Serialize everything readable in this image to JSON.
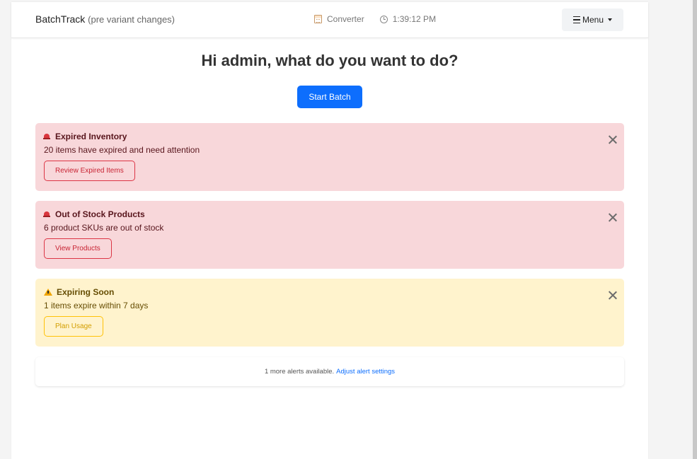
{
  "navbar": {
    "brand": "BatchTrack",
    "brand_sub": "(pre variant changes)",
    "converter_label": "Converter",
    "time": "1:39:12 PM",
    "menu_label": "Menu"
  },
  "hero": {
    "greeting": "Hi admin, what do you want to do?",
    "start_batch_label": "Start Batch"
  },
  "alerts": [
    {
      "level": "danger",
      "icon": "siren-icon",
      "title": "Expired Inventory",
      "message": "20 items have expired and need attention",
      "action_label": "Review Expired Items"
    },
    {
      "level": "danger",
      "icon": "siren-icon",
      "title": "Out of Stock Products",
      "message": "6 product SKUs are out of stock",
      "action_label": "View Products"
    },
    {
      "level": "warning",
      "icon": "warning-icon",
      "title": "Expiring Soon",
      "message": "1 items expire within 7 days",
      "action_label": "Plan Usage"
    }
  ],
  "more_alerts": {
    "text": "1 more alerts available.",
    "link_label": "Adjust alert settings"
  },
  "colors": {
    "primary": "#0d6efd",
    "danger_bg": "#f8d7da",
    "warning_bg": "#fff3cd"
  }
}
